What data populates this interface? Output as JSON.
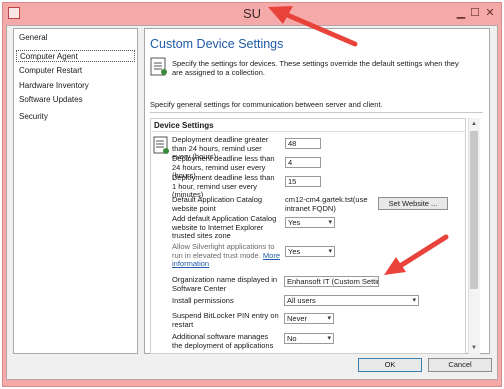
{
  "window": {
    "title": "SU"
  },
  "sidebar": {
    "items": [
      {
        "label": "General"
      },
      {
        "label": "Computer Agent"
      },
      {
        "label": "Computer Restart"
      },
      {
        "label": "Hardware Inventory"
      },
      {
        "label": "Software Updates"
      },
      {
        "label": "Security"
      }
    ],
    "selected": "Computer Agent"
  },
  "main": {
    "heading": "Custom Device Settings",
    "description": "Specify the settings for devices. These settings override the default settings when they are assigned to a collection.",
    "general_note": "Specify general settings for communication between server and client.",
    "section": "Device Settings",
    "settings": [
      {
        "label": "Deployment deadline greater than 24 hours, remind user every (hours)",
        "value": "48"
      },
      {
        "label": "Deployment deadline less than 24 hours, remind user every (hours)",
        "value": "4"
      },
      {
        "label": "Deployment deadline less than 1 hour, remind user every (minutes)",
        "value": "15"
      },
      {
        "label": "Default Application Catalog website point",
        "value": "cm12-cm4.gartek.tst(use intranet FQDN)",
        "button": "Set Website ..."
      },
      {
        "label": "Add default Application Catalog website to Internet Explorer trusted sites zone",
        "value": "Yes"
      },
      {
        "label": "Allow Silverlight applications to run in elevated trust mode.",
        "link": "More information",
        "value": "Yes"
      },
      {
        "label": "Organization name displayed in Software Center",
        "value": "Enhansoft IT (Custom Settings)"
      },
      {
        "label": "Install permissions",
        "value": "All users"
      },
      {
        "label": "Suspend BitLocker PIN entry on restart",
        "value": "Never"
      },
      {
        "label": "Additional software manages the deployment of applications and",
        "value": "No"
      }
    ]
  },
  "footer": {
    "ok": "OK",
    "cancel": "Cancel"
  },
  "annotations": {
    "arrow_color": "#e8423a"
  }
}
